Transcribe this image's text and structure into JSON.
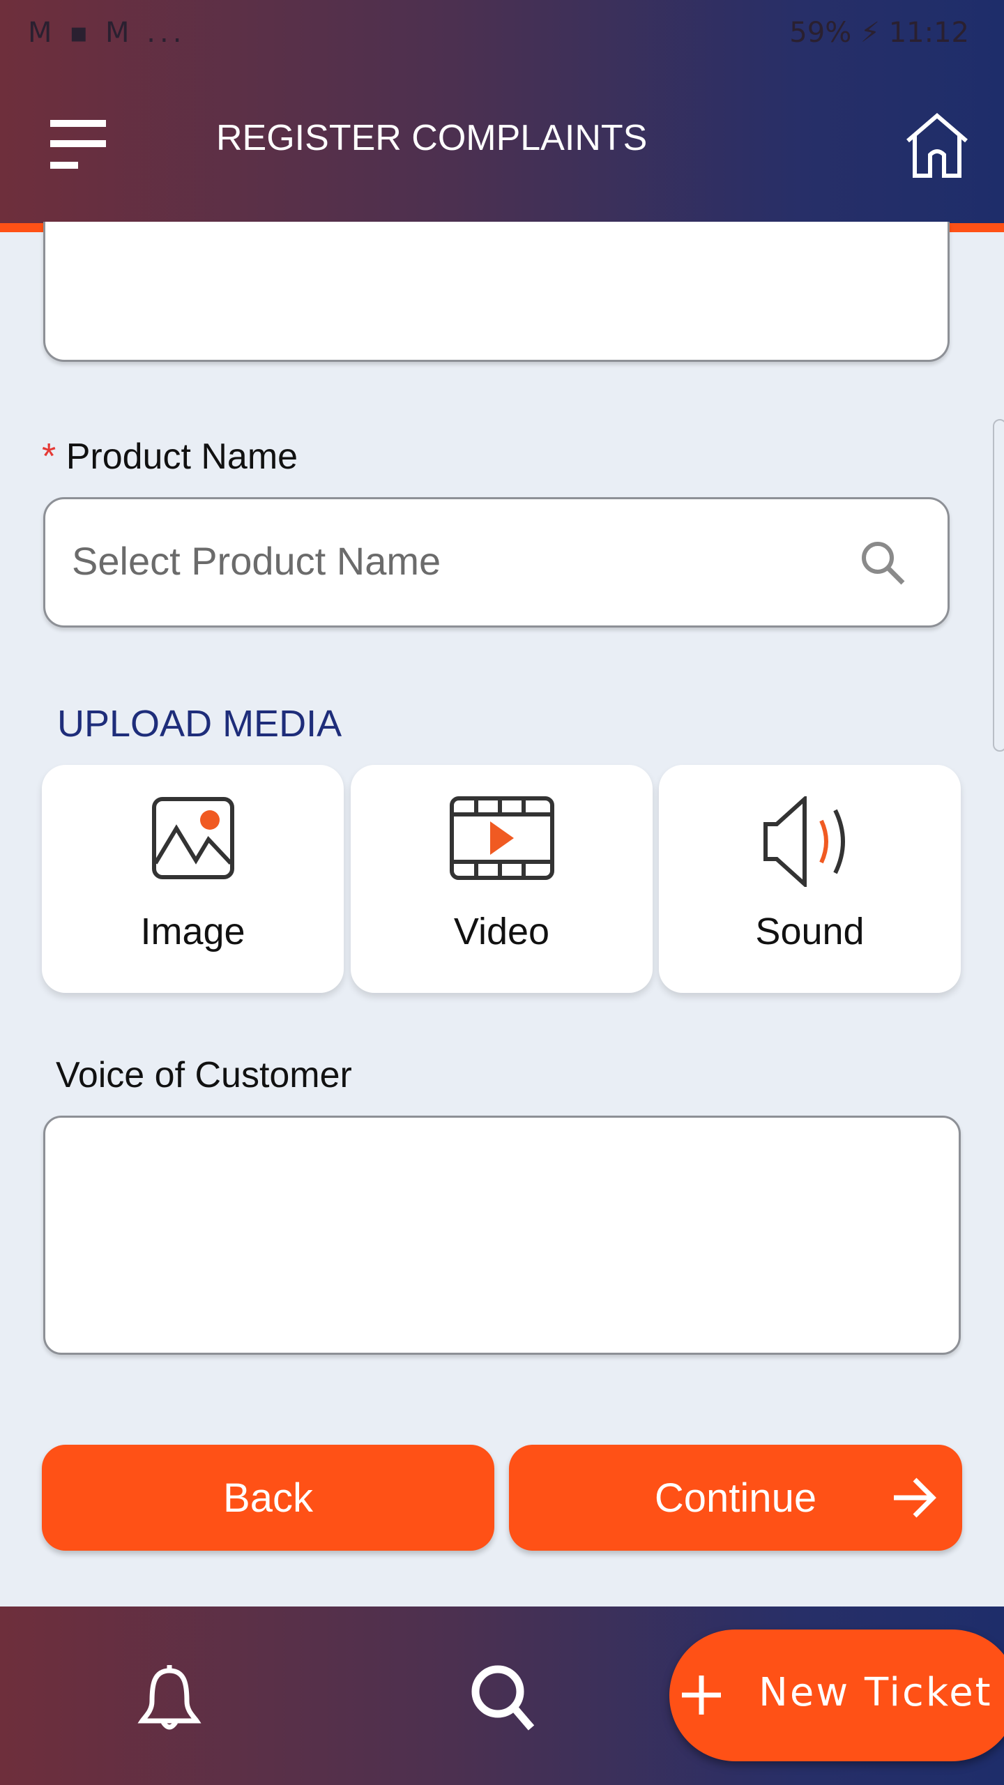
{
  "status_bar": {
    "notifications": "M ▪ M ...",
    "battery": "59%",
    "time": "11:12"
  },
  "header": {
    "title": "REGISTER COMPLAINTS",
    "menu_icon": "menu-icon",
    "home_icon": "home-icon"
  },
  "form": {
    "product_name": {
      "required_mark": "*",
      "label": "Product Name",
      "placeholder": "Select Product Name"
    },
    "upload_media": {
      "title": "UPLOAD MEDIA",
      "items": [
        {
          "label": "Image",
          "icon": "image-icon"
        },
        {
          "label": "Video",
          "icon": "video-icon"
        },
        {
          "label": "Sound",
          "icon": "sound-icon"
        }
      ]
    },
    "voice_of_customer": {
      "label": "Voice of Customer",
      "value": ""
    }
  },
  "actions": {
    "back": "Back",
    "continue": "Continue"
  },
  "bottom_nav": {
    "new_ticket": "New Ticket"
  },
  "colors": {
    "accent": "#ff5116",
    "upload_title": "#1e2d7a"
  }
}
